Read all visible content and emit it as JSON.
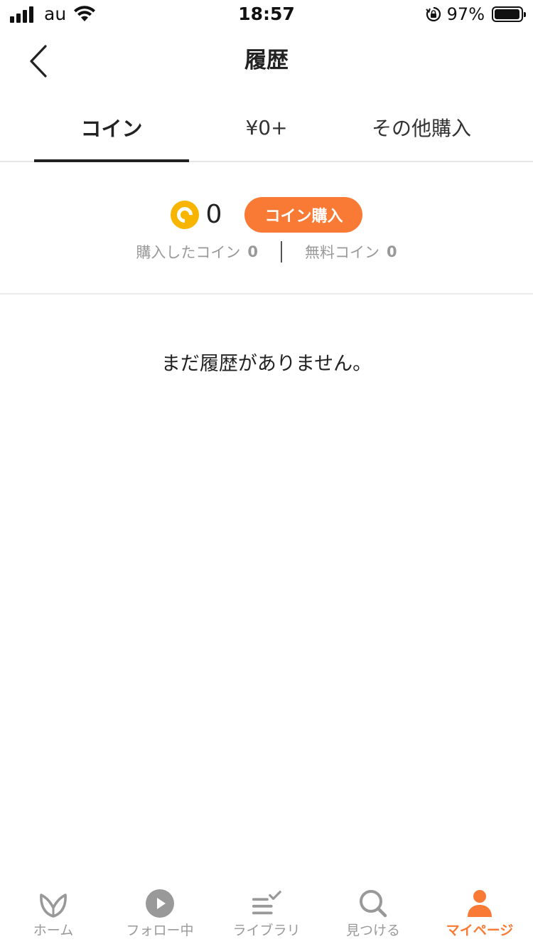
{
  "status_bar": {
    "carrier": "au",
    "time": "18:57",
    "battery_percent": "97%",
    "battery_level": 0.97
  },
  "nav": {
    "title": "履歴"
  },
  "tabs": [
    {
      "label": "コイン",
      "active": true
    },
    {
      "label": "¥0+",
      "active": false
    },
    {
      "label": "その他購入",
      "active": false
    }
  ],
  "coins": {
    "total": "0",
    "buy_button_label": "コイン購入",
    "purchased_label": "購入したコイン",
    "purchased_value": "0",
    "free_label": "無料コイン",
    "free_value": "0"
  },
  "empty_state": {
    "message": "まだ履歴がありません。"
  },
  "bottom_tabs": [
    {
      "label": "ホーム",
      "icon": "home-leaf-icon",
      "active": false
    },
    {
      "label": "フォロー中",
      "icon": "play-circle-icon",
      "active": false
    },
    {
      "label": "ライブラリ",
      "icon": "library-list-icon",
      "active": false
    },
    {
      "label": "見つける",
      "icon": "search-icon",
      "active": false
    },
    {
      "label": "マイページ",
      "icon": "person-icon",
      "active": true
    }
  ],
  "colors": {
    "accent": "#f97a35",
    "coin": "#f7b500",
    "inactive": "#999999",
    "text": "#222222"
  }
}
